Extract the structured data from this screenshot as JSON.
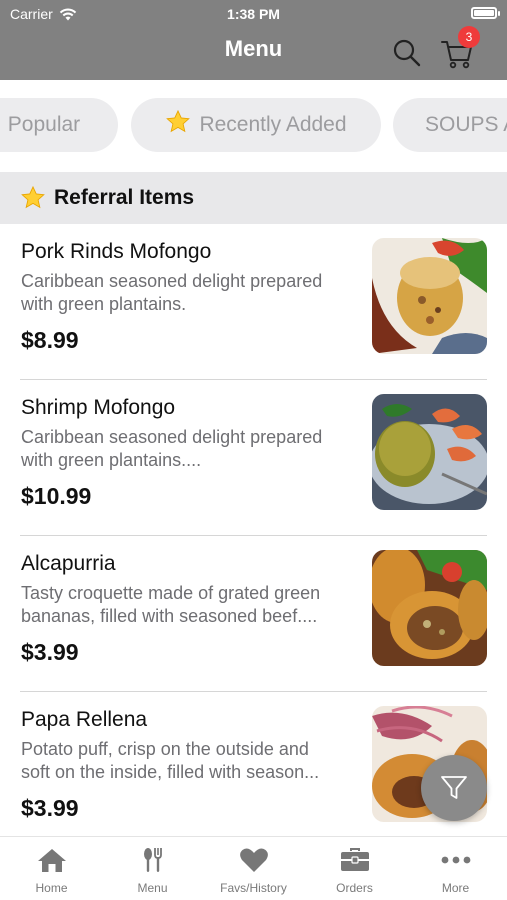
{
  "status_bar": {
    "carrier": "Carrier",
    "time": "1:38 PM"
  },
  "header": {
    "title": "Menu",
    "cart_count": "3"
  },
  "categories": [
    {
      "label": "Popular",
      "selected": false
    },
    {
      "label": "Recently Added",
      "selected": false,
      "icon": "star-icon"
    },
    {
      "label": "SOUPS A",
      "selected": false
    }
  ],
  "section": {
    "title": "Referral Items",
    "icon": "star-icon"
  },
  "items": [
    {
      "name": "Pork Rinds Mofongo",
      "desc_line1": "Caribbean seasoned delight prepared",
      "desc_line2": "with green plantains.",
      "price": "$8.99"
    },
    {
      "name": "Shrimp Mofongo",
      "desc_line1": "Caribbean seasoned delight prepared",
      "desc_line2": "with green plantains....",
      "price": "$10.99"
    },
    {
      "name": "Alcapurria",
      "desc_line1": "Tasty croquette made of grated green",
      "desc_line2": "bananas, filled with seasoned beef....",
      "price": "$3.99"
    },
    {
      "name": "Papa Rellena",
      "desc_line1": "Potato puff, crisp on the outside and",
      "desc_line2": "soft on the inside, filled with season...",
      "price": "$3.99"
    }
  ],
  "tabs": [
    {
      "label": "Home",
      "icon": "home-icon"
    },
    {
      "label": "Menu",
      "icon": "utensils-icon"
    },
    {
      "label": "Favs/History",
      "icon": "heart-icon"
    },
    {
      "label": "Orders",
      "icon": "orders-icon"
    },
    {
      "label": "More",
      "icon": "more-icon"
    }
  ],
  "colors": {
    "header_bg": "#818181",
    "badge": "#ef3b3b",
    "chip_bg": "#ececee",
    "section_bg": "#e8e8ea"
  }
}
